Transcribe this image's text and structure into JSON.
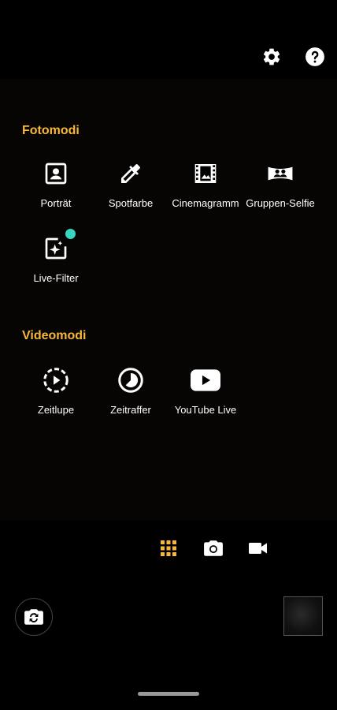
{
  "top": {
    "settings_icon": "gear-icon",
    "help_icon": "help-icon"
  },
  "photo_modes": {
    "title": "Fotomodi",
    "items": [
      {
        "label": "Porträt",
        "icon": "portrait-icon"
      },
      {
        "label": "Spotfarbe",
        "icon": "eyedropper-icon"
      },
      {
        "label": "Cinemagramm",
        "icon": "film-icon"
      },
      {
        "label": "Gruppen-Selfie",
        "icon": "group-icon"
      },
      {
        "label": "Live-Filter",
        "icon": "sparkle-filter-icon",
        "has_new_dot": true
      }
    ]
  },
  "video_modes": {
    "title": "Videomodi",
    "items": [
      {
        "label": "Zeitlupe",
        "icon": "slow-motion-icon"
      },
      {
        "label": "Zeitraffer",
        "icon": "timelapse-icon"
      },
      {
        "label": "YouTube Live",
        "icon": "youtube-icon"
      }
    ]
  },
  "mode_switcher": {
    "active": "modes-grid",
    "items": [
      "grid-icon",
      "camera-icon",
      "video-camera-icon"
    ]
  },
  "colors": {
    "accent": "#f6b73c",
    "new_dot": "#38d6c2"
  }
}
